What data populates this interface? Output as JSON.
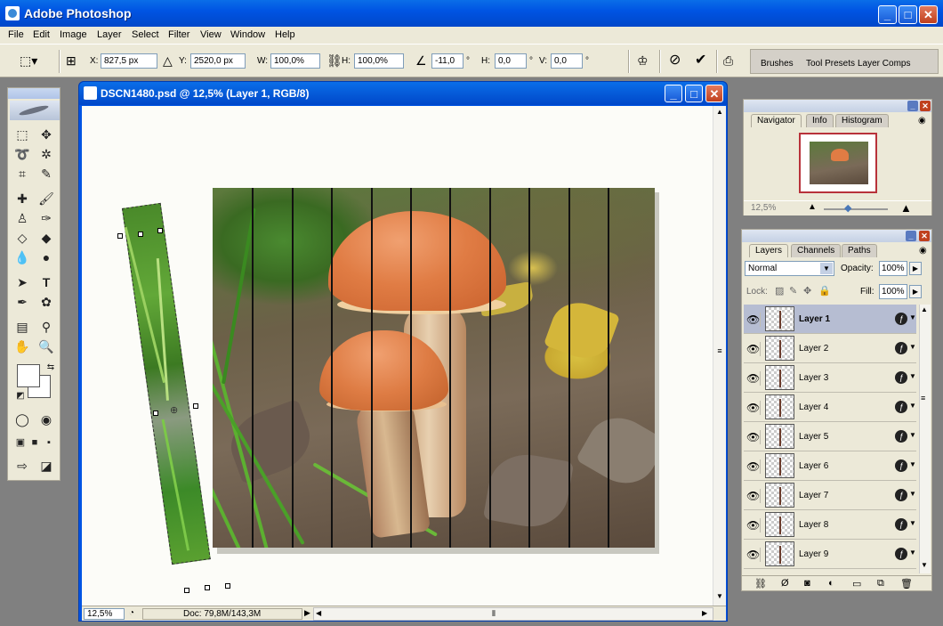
{
  "app": {
    "title": "Adobe Photoshop"
  },
  "menu": [
    "File",
    "Edit",
    "Image",
    "Layer",
    "Select",
    "Filter",
    "View",
    "Window",
    "Help"
  ],
  "options": {
    "x_label": "X:",
    "x_value": "827,5 px",
    "y_label": "Y:",
    "y_value": "2520,0 px",
    "w_label": "W:",
    "w_value": "100,0%",
    "h_label": "H:",
    "h_value": "100,0%",
    "angle_value": "-11,0",
    "deg": "°",
    "hskew_label": "H:",
    "hskew_value": "0,0",
    "vskew_label": "V:",
    "vskew_value": "0,0",
    "cancel_icon": "cancel-icon",
    "commit_icon": "commit-icon"
  },
  "palette_well": {
    "tabs": [
      "Brushes",
      "Tool Presets",
      "Layer Comps"
    ]
  },
  "document": {
    "title": "DSCN1480.psd @ 12,5% (Layer 1, RGB/8)",
    "zoom": "12,5%",
    "doc_size": "Doc: 79,8M/143,3M"
  },
  "navigator": {
    "tabs": [
      "Navigator",
      "Info",
      "Histogram"
    ],
    "zoom": "12,5%"
  },
  "layers": {
    "tabs": [
      "Layers",
      "Channels",
      "Paths"
    ],
    "blend_mode": "Normal",
    "opacity_label": "Opacity:",
    "opacity_value": "100%",
    "lock_label": "Lock:",
    "fill_label": "Fill:",
    "fill_value": "100%",
    "fx_label": "ƒ",
    "items": [
      {
        "name": "Layer 1",
        "selected": true
      },
      {
        "name": "Layer 2"
      },
      {
        "name": "Layer 3"
      },
      {
        "name": "Layer 4"
      },
      {
        "name": "Layer 5"
      },
      {
        "name": "Layer 6"
      },
      {
        "name": "Layer 7"
      },
      {
        "name": "Layer 8"
      },
      {
        "name": "Layer 9"
      }
    ]
  },
  "colors": {
    "titlebar": "#0054e3",
    "chrome": "#ece9d8",
    "selected_layer": "#b6bdd2",
    "close_red": "#c0401e"
  }
}
